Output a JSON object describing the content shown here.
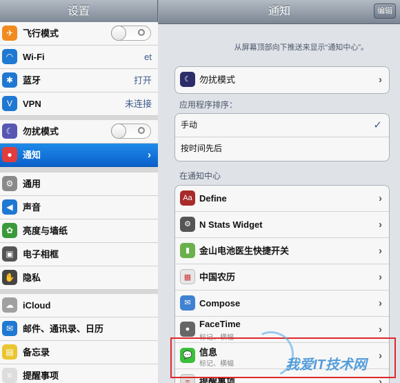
{
  "left": {
    "title": "设置",
    "items": [
      {
        "label": "飞行模式",
        "icon": "airplane-icon",
        "color": "#f28b1f",
        "type": "toggle",
        "value": ""
      },
      {
        "label": "Wi-Fi",
        "icon": "wifi-icon",
        "color": "#1f78d1",
        "type": "value",
        "value": "et"
      },
      {
        "label": "蓝牙",
        "icon": "bluetooth-icon",
        "color": "#1f78d1",
        "type": "value",
        "value": "打开"
      },
      {
        "label": "VPN",
        "icon": "vpn-icon",
        "color": "#1f78d1",
        "type": "value",
        "value": "未连接"
      },
      {
        "label": "勿扰模式",
        "icon": "moon-icon",
        "color": "#5757b3",
        "type": "toggle",
        "value": ""
      },
      {
        "label": "通知",
        "icon": "notification-icon",
        "color": "#e23d3d",
        "type": "chevron",
        "value": ""
      },
      {
        "label": "通用",
        "icon": "gear-icon",
        "color": "#8a8a8a",
        "type": "none",
        "value": ""
      },
      {
        "label": "声音",
        "icon": "speaker-icon",
        "color": "#1f78d1",
        "type": "none",
        "value": ""
      },
      {
        "label": "亮度与墙纸",
        "icon": "flower-icon",
        "color": "#3a9a3a",
        "type": "none",
        "value": ""
      },
      {
        "label": "电子相框",
        "icon": "frame-icon",
        "color": "#555555",
        "type": "none",
        "value": ""
      },
      {
        "label": "隐私",
        "icon": "hand-icon",
        "color": "#444444",
        "type": "none",
        "value": ""
      },
      {
        "label": "iCloud",
        "icon": "cloud-icon",
        "color": "#a0a0a0",
        "type": "none",
        "value": ""
      },
      {
        "label": "邮件、通讯录、日历",
        "icon": "mail-icon",
        "color": "#1f78d1",
        "type": "none",
        "value": ""
      },
      {
        "label": "备忘录",
        "icon": "notes-icon",
        "color": "#e9c630",
        "type": "none",
        "value": ""
      },
      {
        "label": "提醒事项",
        "icon": "reminders-icon",
        "color": "#dddddd",
        "type": "none",
        "value": ""
      }
    ]
  },
  "right": {
    "title": "通知",
    "edit_label": "编辑",
    "description": "从屏幕顶部向下推送来显示“通知中心”。",
    "dnd": {
      "label": "勿扰模式",
      "icon": "moon-icon",
      "color": "#2d2d6a"
    },
    "sort_header": "应用程序排序：",
    "sort_options": [
      {
        "label": "手动",
        "checked": true
      },
      {
        "label": "按时间先后",
        "checked": false
      }
    ],
    "in_center_header": "在通知中心",
    "apps": [
      {
        "label": "Define",
        "icon": "define-icon",
        "color": "#a82b2b",
        "glyph": "Aa",
        "sub": ""
      },
      {
        "label": "N Stats Widget",
        "icon": "gear-icon",
        "color": "#555555",
        "glyph": "⚙",
        "sub": ""
      },
      {
        "label": "金山电池医生快捷开关",
        "icon": "battery-icon",
        "color": "#6ab04c",
        "glyph": "▮",
        "sub": ""
      },
      {
        "label": "中国农历",
        "icon": "calendar-icon",
        "color": "#e7e7e7",
        "glyph": "▦",
        "sub": ""
      },
      {
        "label": "Compose",
        "icon": "compose-icon",
        "color": "#3f82d1",
        "glyph": "✉",
        "sub": ""
      },
      {
        "label": "FaceTime",
        "icon": "facetime-icon",
        "color": "#666666",
        "glyph": "●",
        "sub": "标记、横幅"
      },
      {
        "label": "信息",
        "icon": "messages-icon",
        "color": "#3cbf3c",
        "glyph": "💬",
        "sub": "标记、横幅"
      },
      {
        "label": "提醒事项",
        "icon": "reminders-icon",
        "color": "#dddddd",
        "glyph": "≡",
        "sub": ""
      }
    ]
  },
  "watermark": "我爱IT技术网"
}
